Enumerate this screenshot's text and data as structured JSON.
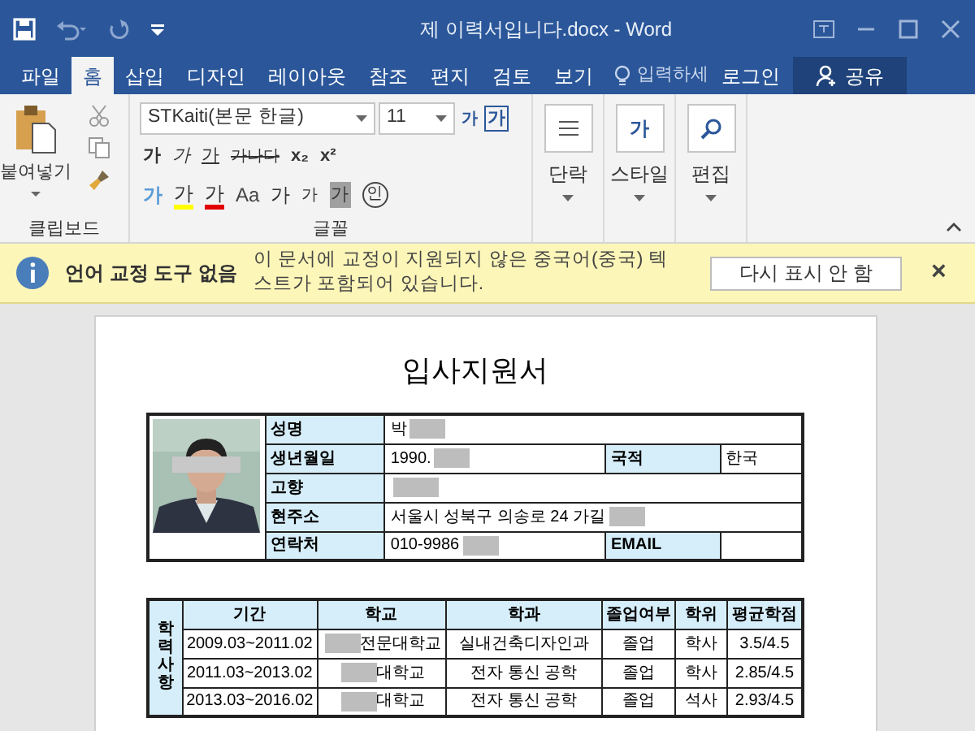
{
  "window": {
    "title": "제  이력서입니다.docx - Word"
  },
  "tabs": [
    {
      "label": "파일",
      "selected": false
    },
    {
      "label": "홈",
      "selected": true
    },
    {
      "label": "삽입",
      "selected": false
    },
    {
      "label": "디자인",
      "selected": false
    },
    {
      "label": "레이아웃",
      "selected": false
    },
    {
      "label": "참조",
      "selected": false
    },
    {
      "label": "편지",
      "selected": false
    },
    {
      "label": "검토",
      "selected": false
    },
    {
      "label": "보기",
      "selected": false
    }
  ],
  "tell_me": {
    "placeholder": "입력하세"
  },
  "sign_in": "로그인",
  "share": "공유",
  "ribbon": {
    "paste": "붙여넣기",
    "clipboard_label": "클립보드",
    "font_name": "STKaiti(본문 한글)",
    "font_size": "11",
    "font_label": "글꼴",
    "format_row_1": [
      {
        "kind": "bold",
        "text": "가"
      },
      {
        "kind": "italic",
        "text": "가"
      },
      {
        "kind": "underline",
        "text": "가"
      },
      {
        "kind": "strike",
        "text": "가나다"
      },
      {
        "kind": "sub",
        "text": "x₂"
      },
      {
        "kind": "sup",
        "text": "x²"
      }
    ],
    "format_row_2": [
      {
        "kind": "effect",
        "text": "가"
      },
      {
        "kind": "highlight",
        "text": "가"
      },
      {
        "kind": "color",
        "text": "가"
      },
      {
        "kind": "case",
        "text": "Aa"
      },
      {
        "kind": "grow",
        "text": "가"
      },
      {
        "kind": "shrink",
        "text": "가"
      },
      {
        "kind": "shade",
        "text": "가"
      },
      {
        "kind": "enclose",
        "text": "인"
      }
    ],
    "phonetic": "가",
    "clear": "가",
    "paragraph": "단락",
    "styles": "스타일",
    "styles_glyph": "가",
    "editing": "편집"
  },
  "infobar": {
    "title": "언어 교정 도구 없음",
    "message": "이 문서에 교정이 지원되지 않은 중국어(중국) 텍스트가 포함되어 있습니다.",
    "button": "다시 표시 안 함",
    "close": "×"
  },
  "document": {
    "heading": "입사지원서",
    "profile": [
      [
        {
          "label": "성명",
          "value": "박",
          "redacted": true
        }
      ],
      [
        {
          "label": "생년월일",
          "value": "1990.",
          "redacted": true
        },
        {
          "label": "국적",
          "value": "한국",
          "redacted": false
        }
      ],
      [
        {
          "label": "고향",
          "redacted": true
        }
      ],
      [
        {
          "label": "현주소",
          "value": "서울시 성북구 의송로 24 가길",
          "redacted": true
        }
      ],
      [
        {
          "label": "연락처",
          "value": "010-9986",
          "redacted": true
        },
        {
          "label": "EMAIL",
          "redacted": false
        }
      ]
    ],
    "education": {
      "side_label": "학력사항",
      "columns": [
        "기간",
        "학교",
        "학과",
        "졸업여부",
        "학위",
        "평균학점"
      ],
      "rows": [
        [
          {
            "text": "2009.03~2011.02",
            "redacted": false
          },
          {
            "text": "전문대학교",
            "redacted": true
          },
          {
            "text": "실내건축디자인과",
            "redacted": false
          },
          {
            "text": "졸업",
            "redacted": false
          },
          {
            "text": "학사",
            "redacted": false
          },
          {
            "text": "3.5/4.5",
            "redacted": false
          }
        ],
        [
          {
            "text": "2011.03~2013.02",
            "redacted": false
          },
          {
            "text": "대학교",
            "redacted": true
          },
          {
            "text": "전자 통신 공학",
            "redacted": false
          },
          {
            "text": "졸업",
            "redacted": false
          },
          {
            "text": "학사",
            "redacted": false
          },
          {
            "text": "2.85/4.5",
            "redacted": false
          }
        ],
        [
          {
            "text": "2013.03~2016.02",
            "redacted": false
          },
          {
            "text": "대학교",
            "redacted": true
          },
          {
            "text": "전자 통신 공학",
            "redacted": false
          },
          {
            "text": "졸업",
            "redacted": false
          },
          {
            "text": "석사",
            "redacted": false
          },
          {
            "text": "2.93/4.5",
            "redacted": false
          }
        ]
      ]
    }
  }
}
